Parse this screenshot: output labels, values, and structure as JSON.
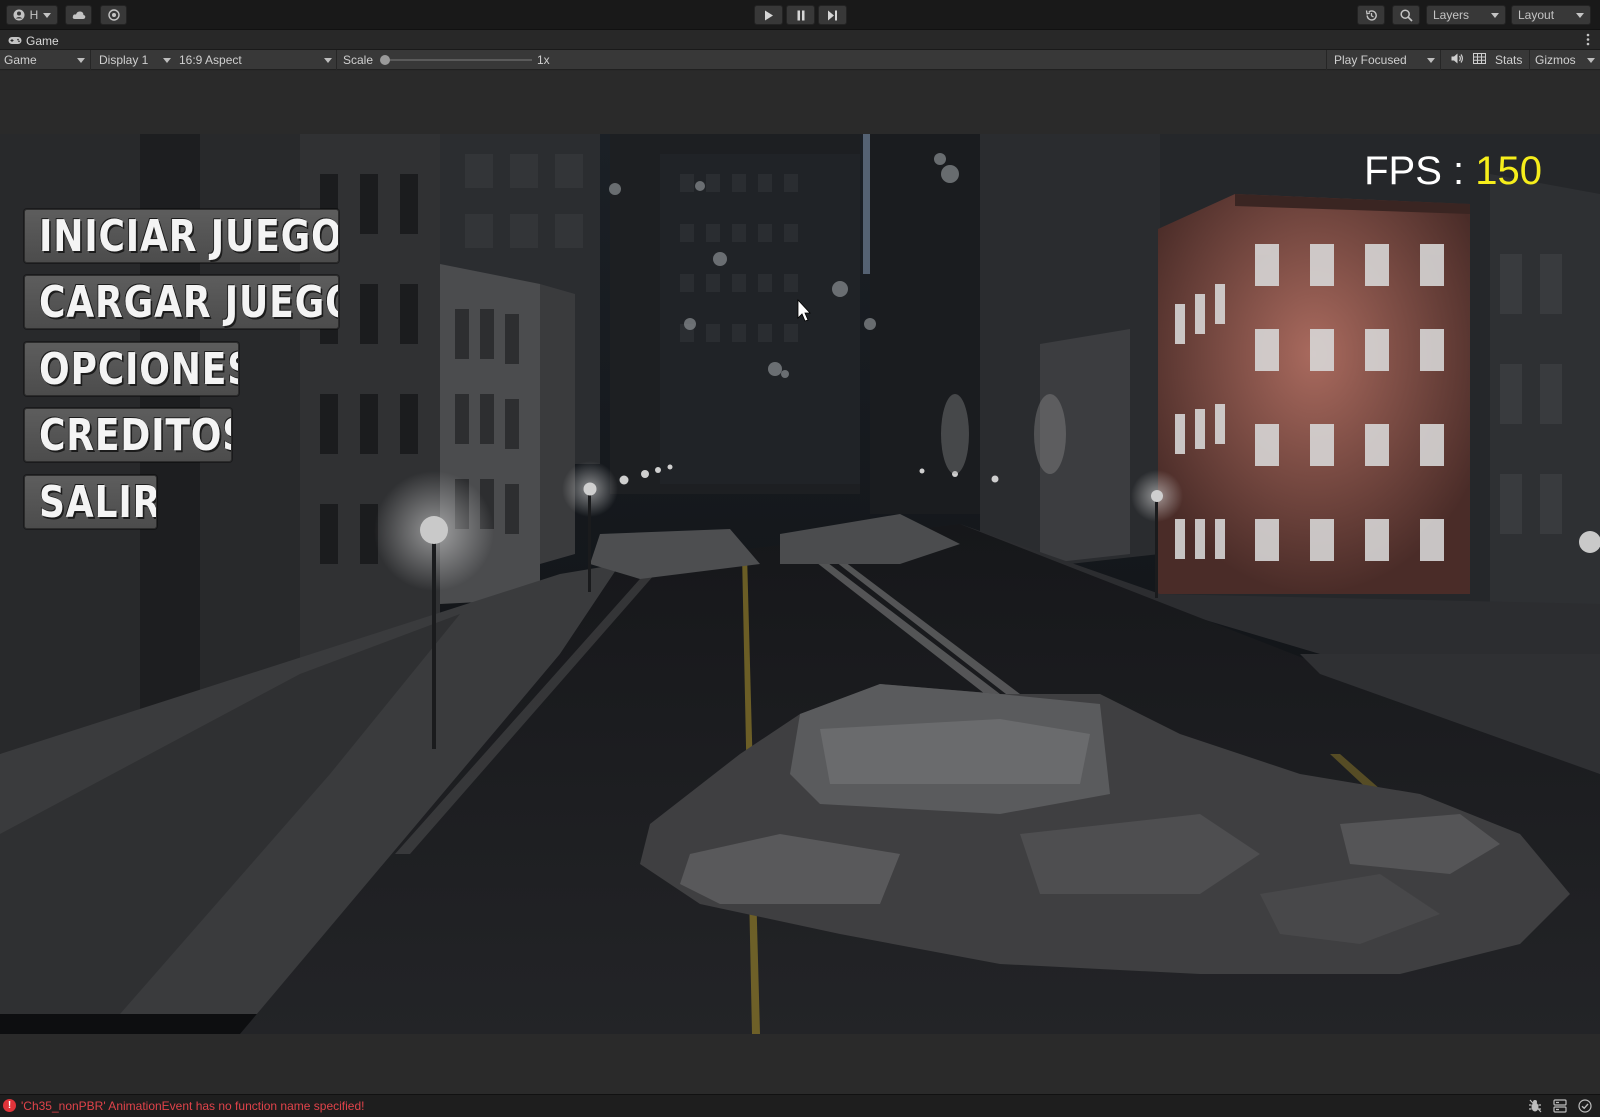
{
  "toolbar": {
    "account_label": "H",
    "layers_label": "Layers",
    "layout_label": "Layout",
    "icons": [
      "account-icon",
      "cloud-icon",
      "collab-icon",
      "play-icon",
      "pause-icon",
      "step-icon",
      "history-icon",
      "search-icon"
    ]
  },
  "tab": {
    "title": "Game",
    "icon": "gamepad-icon"
  },
  "gamebar": {
    "view_select": "Game",
    "display_select": "Display 1",
    "aspect_select": "16:9 Aspect",
    "scale_label": "Scale",
    "scale_value": "1x",
    "play_mode_select": "Play Focused",
    "stats_label": "Stats",
    "gizmos_label": "Gizmos"
  },
  "game": {
    "menu": [
      {
        "label": "INICIAR JUEGO"
      },
      {
        "label": "CARGAR JUEGO"
      },
      {
        "label": "OPCIONES"
      },
      {
        "label": "CREDITOS"
      },
      {
        "label": "SALIR"
      }
    ],
    "fps_label": "FPS :",
    "fps_value": "150",
    "fps_color": "#f6ee1b"
  },
  "statusbar": {
    "error_message": "'Ch35_nonPBR' AnimationEvent has no function name specified!",
    "error_color": "#e0434a"
  }
}
